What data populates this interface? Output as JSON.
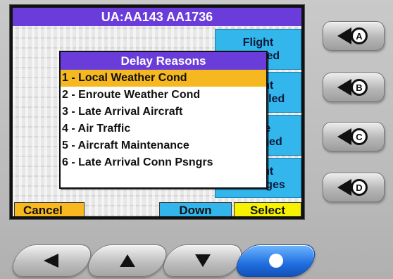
{
  "window": {
    "title": "UA:AA143  AA1736"
  },
  "side_buttons": [
    {
      "label": "Flight\nDelayed"
    },
    {
      "label": "Flight\nCancelled"
    },
    {
      "label": "Gate\nChanged"
    },
    {
      "label": "Flight\nMessages"
    }
  ],
  "bottom_bar": {
    "cancel_label": "Cancel",
    "down_label": "Down",
    "select_label": "Select"
  },
  "popup": {
    "title": "Delay Reasons",
    "selected_index": 0,
    "items": [
      {
        "label": "1 - Local Weather Cond"
      },
      {
        "label": "2 - Enroute Weather Cond"
      },
      {
        "label": "3 - Late Arrival Aircraft"
      },
      {
        "label": "4 - Air Traffic"
      },
      {
        "label": "5 - Aircraft Maintenance"
      },
      {
        "label": "6 - Late Arrival Conn Psngrs"
      }
    ]
  },
  "hardware_buttons": [
    {
      "letter": "A"
    },
    {
      "letter": "B"
    },
    {
      "letter": "C"
    },
    {
      "letter": "D"
    }
  ],
  "nav_buttons": [
    {
      "icon": "arrow-left-icon"
    },
    {
      "icon": "arrow-up-icon"
    },
    {
      "icon": "arrow-down-icon"
    },
    {
      "icon": "circle-icon"
    }
  ],
  "colors": {
    "title_bar": "#6a3ddb",
    "side_button": "#33b6ec",
    "highlight": "#f6b820",
    "select_button": "#f7f300"
  }
}
